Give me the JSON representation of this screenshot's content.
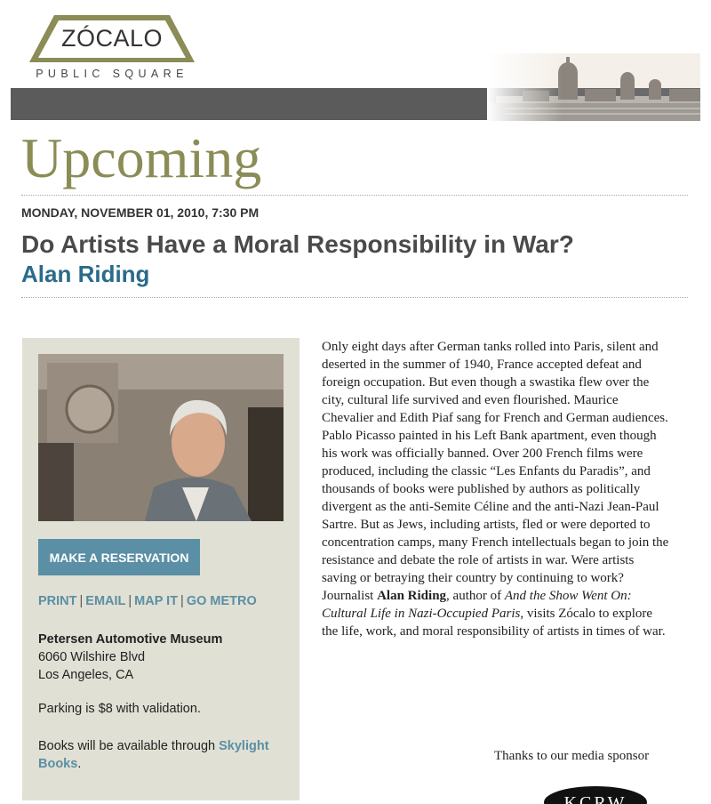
{
  "logo": {
    "word": "ZÓCALO",
    "sub": "PUBLIC SQUARE"
  },
  "page": {
    "title": "Upcoming"
  },
  "event": {
    "date": "MONDAY, NOVEMBER 01, 2010, 7:30 PM",
    "title": "Do Artists Have a Moral Responsibility in War?",
    "speaker": "Alan Riding"
  },
  "sidebar": {
    "reserve_label": "MAKE A RESERVATION",
    "links": {
      "print": "PRINT",
      "email": "EMAIL",
      "map": "MAP IT",
      "metro": "GO METRO",
      "separator": "|"
    },
    "venue": {
      "name": "Petersen Automotive Museum",
      "street": "6060 Wilshire Blvd",
      "city": "Los Angeles, CA"
    },
    "parking": "Parking is $8 with validation.",
    "books": {
      "prefix": "Books will be available through",
      "link": "Skylight Books",
      "suffix": "."
    }
  },
  "description": {
    "part1": "Only eight days after German tanks rolled into Paris, silent and deserted in the summer of 1940, France accepted defeat and foreign occupation. But even though a swastika flew over the city, cultural life survived and even flourished. Maurice Chevalier and Edith Piaf sang for French and German audiences. Pablo Picasso painted in his Left Bank apartment, even though his work was officially banned. Over 200 French films were produced, including the classic “Les Enfants du Paradis”, and thousands of books were published by authors as politically divergent as the anti-Semite Céline and the anti-Nazi Jean-Paul Sartre. But as Jews, including artists, fled or were deported to concentration camps, many French intellectuals began to join the resistance and debate the role of artists in war. Were artists saving or betraying their country by continuing to work? Journalist",
    "speaker": "Alan Riding",
    "part2": ", author of",
    "book": "And the Show Went On: Cultural Life in Nazi-Occupied Paris",
    "part3": ", visits Zócalo to explore the life, work, and moral responsibility of artists in times of war."
  },
  "sponsor": {
    "text": "Thanks to our media sponsor",
    "logo_text": "KCRW"
  },
  "colors": {
    "title_olive": "#8b8c56",
    "speaker_blue": "#2a6b8a",
    "link_blue": "#5b8fa5",
    "sidebar_bg": "#e0e0d4",
    "band_gray": "#5b5b5b"
  }
}
